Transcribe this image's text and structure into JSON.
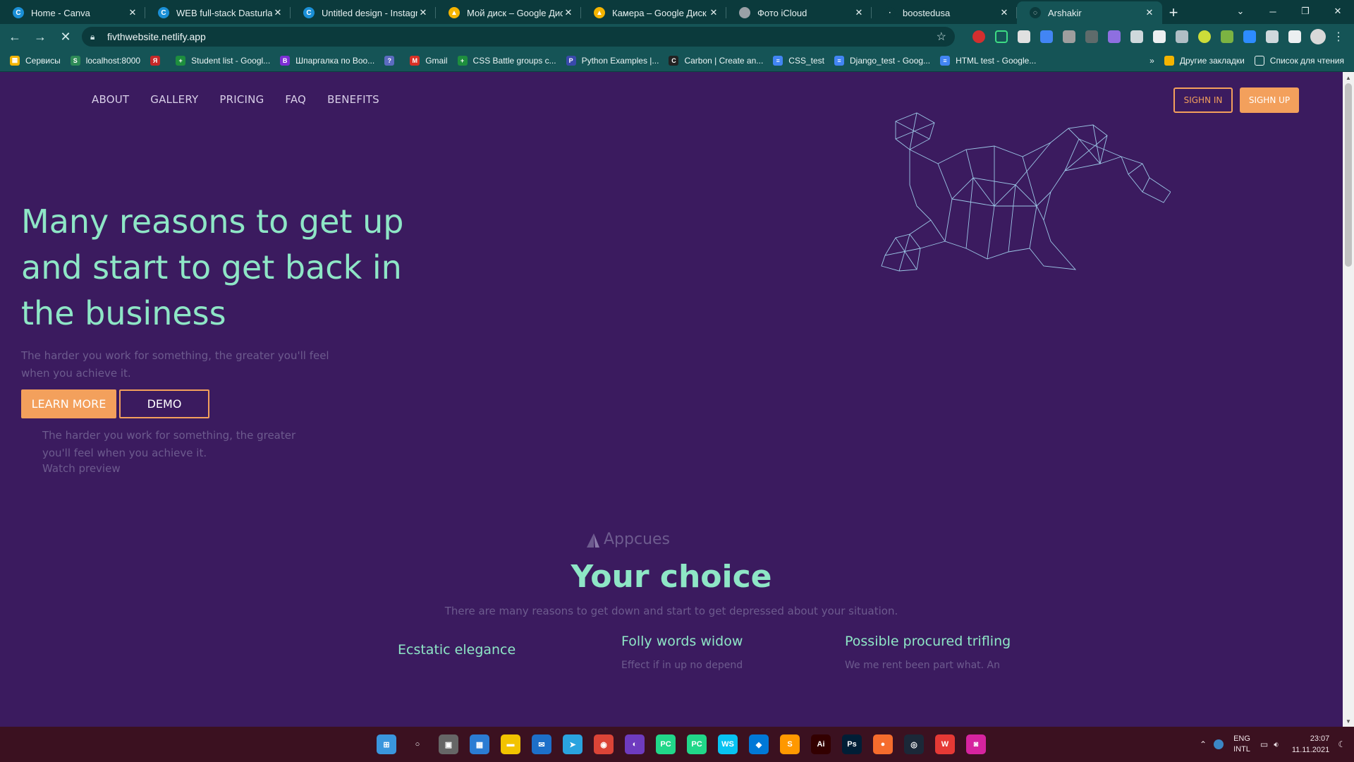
{
  "browser": {
    "tabs": [
      {
        "title": "Home - Canva",
        "favicon_color": "#1a8fd6",
        "favicon_glyph": "C"
      },
      {
        "title": "WEB full-stack Dasturlash",
        "favicon_color": "#1a8fd6",
        "favicon_glyph": "C"
      },
      {
        "title": "Untitled design - Instagram",
        "favicon_color": "#1a8fd6",
        "favicon_glyph": "C"
      },
      {
        "title": "Мой диск – Google Диск",
        "favicon_color": "#f4b400",
        "favicon_glyph": "▲"
      },
      {
        "title": "Камера – Google Диск",
        "favicon_color": "#f4b400",
        "favicon_glyph": "▲"
      },
      {
        "title": "Фото iCloud",
        "favicon_color": "#9aa0a6",
        "favicon_glyph": ""
      },
      {
        "title": "boostedusa",
        "favicon_color": "#0b3a3c",
        "favicon_glyph": "·"
      },
      {
        "title": "Arshakir",
        "favicon_color": "#0b3a3c",
        "favicon_glyph": "◌",
        "active": true
      }
    ],
    "address": "fivthwebsite.netlify.app",
    "bookmarks": [
      {
        "label": "Сервисы",
        "icon_color": "#f4b400",
        "glyph": "▦"
      },
      {
        "label": "localhost:8000",
        "icon_color": "#2e8b57",
        "glyph": "S"
      },
      {
        "label": "",
        "icon_color": "#c62828",
        "glyph": "Я"
      },
      {
        "label": "Student list - Googl...",
        "icon_color": "#1e8e3e",
        "glyph": "+"
      },
      {
        "label": "Шпаргалка по Boo...",
        "icon_color": "#7b2fd4",
        "glyph": "B"
      },
      {
        "label": "",
        "icon_color": "#5c6bc0",
        "glyph": "?"
      },
      {
        "label": "Gmail",
        "icon_color": "#d93025",
        "glyph": "M"
      },
      {
        "label": "CSS Battle groups c...",
        "icon_color": "#1e8e3e",
        "glyph": "+"
      },
      {
        "label": "Python Examples |...",
        "icon_color": "#3949ab",
        "glyph": "P"
      },
      {
        "label": "Carbon | Create an...",
        "icon_color": "#222222",
        "glyph": "C"
      },
      {
        "label": "CSS_test",
        "icon_color": "#4285f4",
        "glyph": "≡"
      },
      {
        "label": "Django_test - Goog...",
        "icon_color": "#4285f4",
        "glyph": "≡"
      },
      {
        "label": "HTML test - Google...",
        "icon_color": "#4285f4",
        "glyph": "≡"
      }
    ],
    "bookmarks_more": "»",
    "other_bookmarks": "Другие закладки",
    "reading_list": "Список для чтения"
  },
  "site": {
    "nav": [
      "ABOUT",
      "GALLERY",
      "PRICING",
      "FAQ",
      "BENEFITS"
    ],
    "sign_in": "SIGHN IN",
    "sign_up": "SIGHN UP",
    "hero": {
      "title": "Many reasons to get up and start to get back in the business",
      "subtitle": "The harder you work for something, the greater you'll feel when you achieve it.",
      "learn_more": "LEARN MORE",
      "demo": "DEMO",
      "preview_text": "The harder you work for something, the greater you'll feel when you achieve it.",
      "preview_link": "Watch preview"
    },
    "brand": "Appcues",
    "section_title": "Your choice",
    "section_subtitle": "There are many reasons to get down and start to get depressed about your situation.",
    "features": [
      {
        "title": "Ecstatic elegance",
        "desc": ""
      },
      {
        "title": "Folly words widow",
        "desc": "Effect if in up no depend"
      },
      {
        "title": "Possible procured trifling",
        "desc": "We me rent been part what. An"
      }
    ]
  },
  "taskbar": {
    "apps": [
      {
        "name": "windows-start-icon",
        "color": "#3a96dd",
        "glyph": "⊞"
      },
      {
        "name": "search-icon",
        "color": "transparent",
        "glyph": "○"
      },
      {
        "name": "task-view-icon",
        "color": "#666666",
        "glyph": "▣"
      },
      {
        "name": "widgets-icon",
        "color": "#2b7cd3",
        "glyph": "▦"
      },
      {
        "name": "file-explorer-icon",
        "color": "#f2c300",
        "glyph": "▬"
      },
      {
        "name": "mail-icon",
        "color": "#1d6fc9",
        "glyph": "✉"
      },
      {
        "name": "telegram-icon",
        "color": "#2aa3df",
        "glyph": "➤"
      },
      {
        "name": "chrome-icon",
        "color": "#db4437",
        "glyph": "◉"
      },
      {
        "name": "github-icon",
        "color": "#6e3bbf",
        "glyph": "◐"
      },
      {
        "name": "pycharm-icon",
        "color": "#21d789",
        "glyph": "PC"
      },
      {
        "name": "pycharm-ce-icon",
        "color": "#21d789",
        "glyph": "PC"
      },
      {
        "name": "webstorm-icon",
        "color": "#07c3f2",
        "glyph": "WS"
      },
      {
        "name": "vscode-icon",
        "color": "#0078d7",
        "glyph": "◆"
      },
      {
        "name": "sublime-icon",
        "color": "#ff9800",
        "glyph": "S"
      },
      {
        "name": "illustrator-icon",
        "color": "#330000",
        "glyph": "Ai"
      },
      {
        "name": "photoshop-icon",
        "color": "#001e36",
        "glyph": "Ps"
      },
      {
        "name": "origin-icon",
        "color": "#f56c2d",
        "glyph": "●"
      },
      {
        "name": "steam-icon",
        "color": "#1b2838",
        "glyph": "◎"
      },
      {
        "name": "wps-icon",
        "color": "#e53935",
        "glyph": "W"
      },
      {
        "name": "instagram-icon",
        "color": "#d6249f",
        "glyph": "◙"
      }
    ],
    "lang_top": "ENG",
    "lang_bottom": "INTL",
    "time": "23:07",
    "date": "11.11.2021"
  },
  "colors": {
    "page_bg": "#3b1b5f",
    "accent_mint": "#8ee6c6",
    "accent_orange": "#f3a05c",
    "muted_text": "#6d5b8e",
    "browser_chrome": "#155456",
    "taskbar": "#3b1120"
  }
}
